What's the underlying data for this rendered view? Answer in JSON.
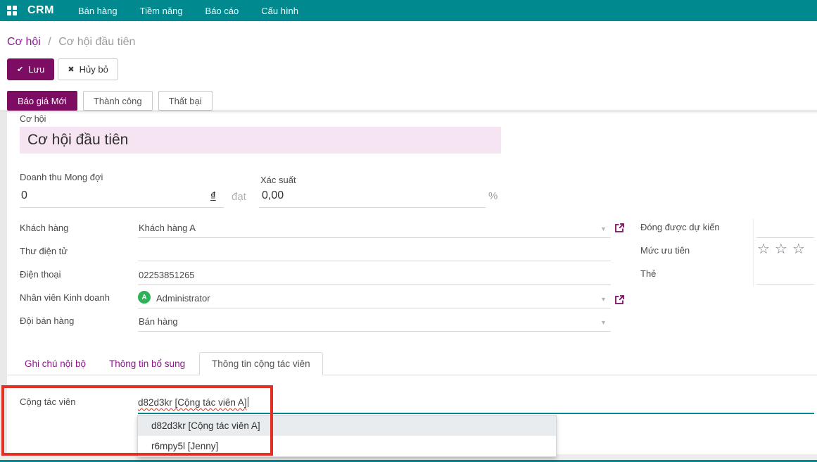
{
  "colors": {
    "topbar_teal": "#00898f",
    "primary_purple": "#7c0d63",
    "link_purple": "#8a1a8c",
    "title_field_bg": "#f6e4f2",
    "avatar_green": "#2bb457",
    "annotation_red": "#e42f22",
    "focus_underline_teal": "#00898f"
  },
  "icons": {
    "check": "✔",
    "cross": "✖",
    "caret": "▾",
    "star": "☆☆☆"
  },
  "topbar": {
    "brand": "CRM",
    "menu": [
      {
        "label": "Bán hàng"
      },
      {
        "label": "Tiềm năng"
      },
      {
        "label": "Báo cáo"
      },
      {
        "label": "Cấu hình"
      }
    ]
  },
  "breadcrumb": {
    "parent": "Cơ hội",
    "separator": "/",
    "current": "Cơ hội đầu tiên"
  },
  "actions": {
    "save": "Lưu",
    "discard": "Hủy bỏ"
  },
  "stages": [
    {
      "label": "Báo giá Mới",
      "active": true
    },
    {
      "label": "Thành công",
      "active": false
    },
    {
      "label": "Thất bại",
      "active": false
    }
  ],
  "form": {
    "title": {
      "label": "Cơ hội",
      "value": "Cơ hội đầu tiên"
    },
    "expected_revenue": {
      "label": "Doanh thu Mong đợi",
      "value": "0",
      "currency": "₫",
      "at_word": "đạt"
    },
    "probability": {
      "label": "Xác suất",
      "value": "0,00",
      "suffix": "%"
    },
    "left_fields": [
      {
        "label": "Khách hàng",
        "value": "Khách hàng A"
      },
      {
        "label": "Thư điện tử",
        "value": ""
      },
      {
        "label": "Điện thoại",
        "value": "02253851265"
      },
      {
        "label": "Nhân viên Kinh doanh",
        "value": "Administrator",
        "avatar_letter": "A"
      },
      {
        "label": "Đội bán hàng",
        "value": "Bán hàng"
      }
    ],
    "right_fields": [
      {
        "label": "Đóng được dự kiến",
        "value": ""
      },
      {
        "label": "Mức ưu tiên",
        "value": ""
      },
      {
        "label": "Thẻ",
        "value": ""
      }
    ]
  },
  "notebook": {
    "tabs": [
      {
        "label": "Ghi chú nội bộ",
        "active": false
      },
      {
        "label": "Thông tin bổ sung",
        "active": false
      },
      {
        "label": "Thông tin cộng tác viên",
        "active": true
      }
    ]
  },
  "collaborator": {
    "label": "Cộng tác viên",
    "input_value": "d82d3kr [Cộng tác viên A]",
    "dropdown": [
      {
        "label": "d82d3kr [Cộng tác viên A]",
        "highlighted": true
      },
      {
        "label": "r6mpy5l [Jenny]",
        "highlighted": false
      }
    ]
  }
}
